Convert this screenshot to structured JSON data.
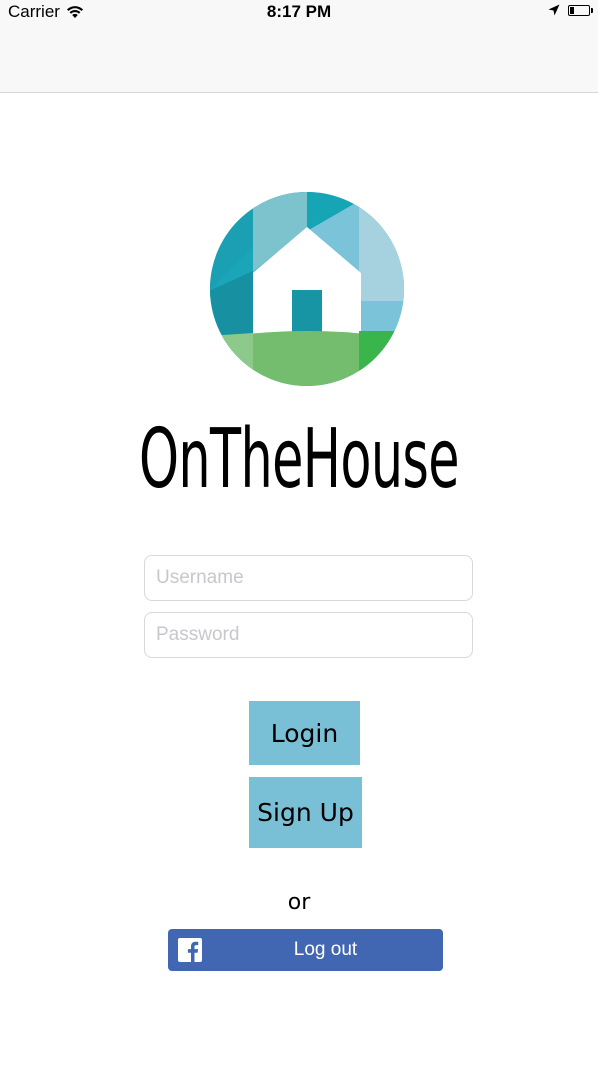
{
  "status_bar": {
    "carrier": "Carrier",
    "time": "8:17 PM"
  },
  "app": {
    "name": "OnTheHouse"
  },
  "login_form": {
    "username_placeholder": "Username",
    "username_value": "",
    "password_placeholder": "Password",
    "password_value": "",
    "login_label": "Login",
    "signup_label": "Sign Up",
    "or_label": "or",
    "facebook_label": "Log out"
  },
  "icons": {
    "wifi": "wifi-icon",
    "location": "location-arrow-icon",
    "battery": "battery-icon",
    "logo": "house-logo-icon",
    "facebook": "facebook-icon"
  },
  "colors": {
    "button": "#79c0d6",
    "facebook": "#4267b2",
    "logo_teal": "#19a3b7",
    "logo_green": "#74bd6e"
  }
}
